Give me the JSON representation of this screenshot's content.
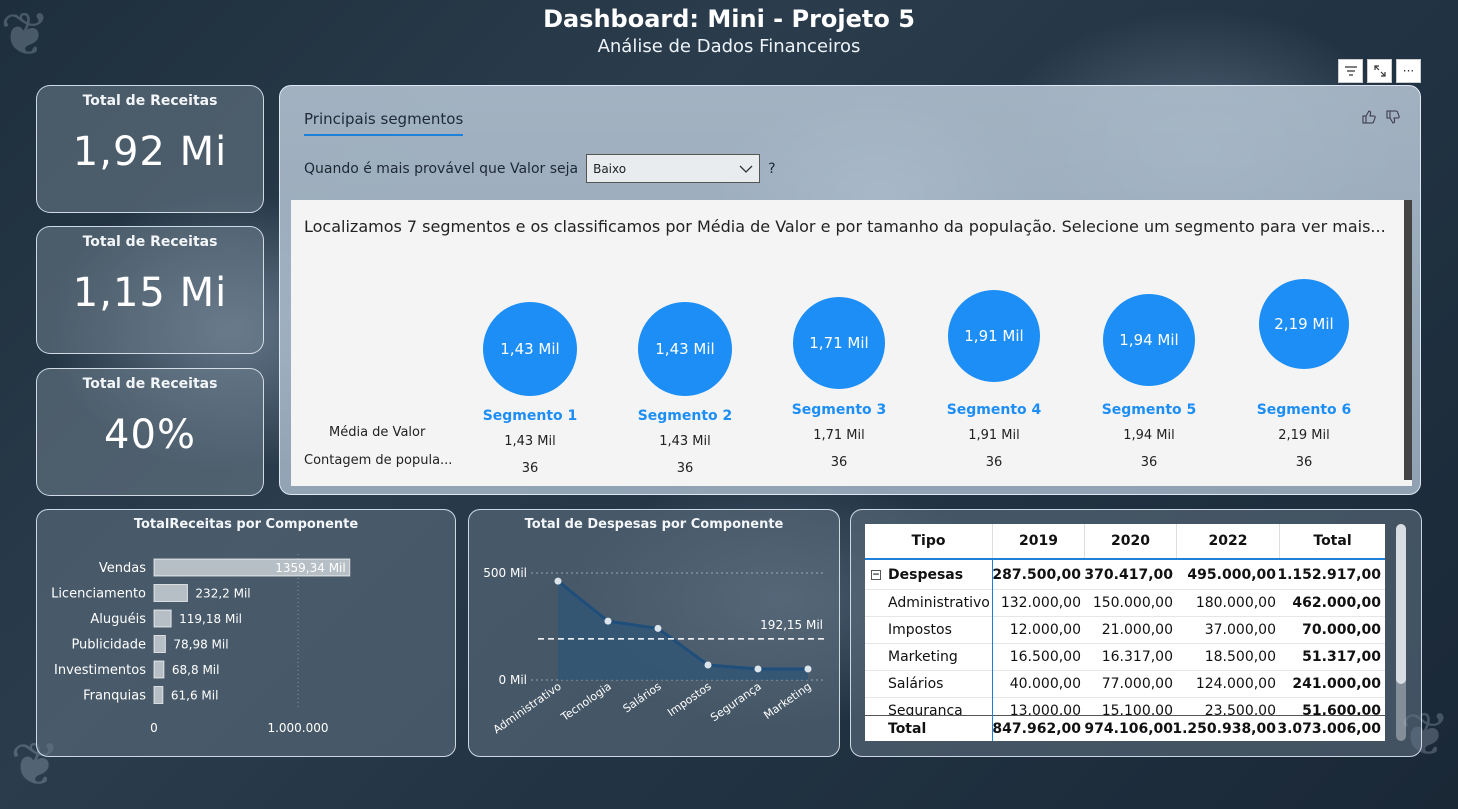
{
  "header": {
    "title": "Dashboard: Mini - Projeto 5",
    "subtitle": "Análise de Dados Financeiros"
  },
  "kpis": [
    {
      "label": "Total de Receitas",
      "value": "1,92 Mi"
    },
    {
      "label": "Total de Receitas",
      "value": "1,15 Mi"
    },
    {
      "label": "Total de Receitas",
      "value": "40%"
    }
  ],
  "toolbar": {
    "filter_icon": "filter-icon",
    "focus_icon": "focus-mode-icon",
    "more_icon": "more-options-icon"
  },
  "segments_panel": {
    "tab_label": "Principais segmentos",
    "question_prefix": "Quando é mais provável que Valor seja",
    "select_value": "Baixo",
    "question_suffix": "?",
    "description": "Localizamos 7 segmentos e os classificamos por Média de Valor e por tamanho da população. Selecione um segmento para ver mais...",
    "row_labels": {
      "mean": "Média de Valor",
      "count": "Contagem de popula..."
    },
    "segments": [
      {
        "name": "Segmento 1",
        "bubble": "1,43 Mil",
        "mean": "1,43 Mil",
        "count": "36"
      },
      {
        "name": "Segmento 2",
        "bubble": "1,43 Mil",
        "mean": "1,43 Mil",
        "count": "36"
      },
      {
        "name": "Segmento 3",
        "bubble": "1,71 Mil",
        "mean": "1,71 Mil",
        "count": "36"
      },
      {
        "name": "Segmento 4",
        "bubble": "1,91 Mil",
        "mean": "1,91 Mil",
        "count": "36"
      },
      {
        "name": "Segmento 5",
        "bubble": "1,94 Mil",
        "mean": "1,94 Mil",
        "count": "36"
      },
      {
        "name": "Segmento 6",
        "bubble": "2,19 Mil",
        "mean": "2,19 Mil",
        "count": "36"
      }
    ]
  },
  "chart_data": [
    {
      "type": "bar",
      "orientation": "horizontal",
      "title": "TotalReceitas por Componente",
      "categories": [
        "Vendas",
        "Licenciamento",
        "Aluguéis",
        "Publicidade",
        "Investimentos",
        "Franquias"
      ],
      "values": [
        1359340,
        232200,
        119180,
        78980,
        68800,
        61600
      ],
      "data_labels": [
        "1359,34 Mil",
        "232,2 Mil",
        "119,18 Mil",
        "78,98 Mil",
        "68,8 Mil",
        "61,6 Mil"
      ],
      "xticks": [
        "0",
        "1.000.000"
      ],
      "xlim": [
        0,
        1600000
      ],
      "grid": true
    },
    {
      "type": "area",
      "title": "Total de Despesas por Componente",
      "categories": [
        "Administrativo",
        "Tecnologia",
        "Salários",
        "Impostos",
        "Segurança",
        "Marketing"
      ],
      "values": [
        462000,
        275000,
        241000,
        70000,
        51600,
        51317
      ],
      "yticks": [
        "500 Mil",
        "0 Mil"
      ],
      "ylim": [
        0,
        520000
      ],
      "average_line": {
        "value": 192150,
        "label": "192,15 Mil"
      },
      "grid": true
    }
  ],
  "table": {
    "headers": [
      "Tipo",
      "2019",
      "2020",
      "2022",
      "Total"
    ],
    "group": {
      "label": "Despesas",
      "values": [
        "287.500,00",
        "370.417,00",
        "495.000,00",
        "1.152.917,00"
      ]
    },
    "rows": [
      {
        "label": "Administrativo",
        "values": [
          "132.000,00",
          "150.000,00",
          "180.000,00",
          "462.000,00"
        ]
      },
      {
        "label": "Impostos",
        "values": [
          "12.000,00",
          "21.000,00",
          "37.000,00",
          "70.000,00"
        ]
      },
      {
        "label": "Marketing",
        "values": [
          "16.500,00",
          "16.317,00",
          "18.500,00",
          "51.317,00"
        ]
      },
      {
        "label": "Salários",
        "values": [
          "40.000,00",
          "77.000,00",
          "124.000,00",
          "241.000,00"
        ]
      },
      {
        "label": "Segurança",
        "values": [
          "13.000,00",
          "15.100,00",
          "23.500,00",
          "51.600,00"
        ]
      }
    ],
    "total": {
      "label": "Total",
      "values": [
        "847.962,00",
        "974.106,00",
        "1.250.938,00",
        "3.073.006,00"
      ]
    }
  },
  "colors": {
    "accent": "#1c8ef5",
    "area_fill": "#2f5677",
    "line": "#1f4e7a"
  }
}
